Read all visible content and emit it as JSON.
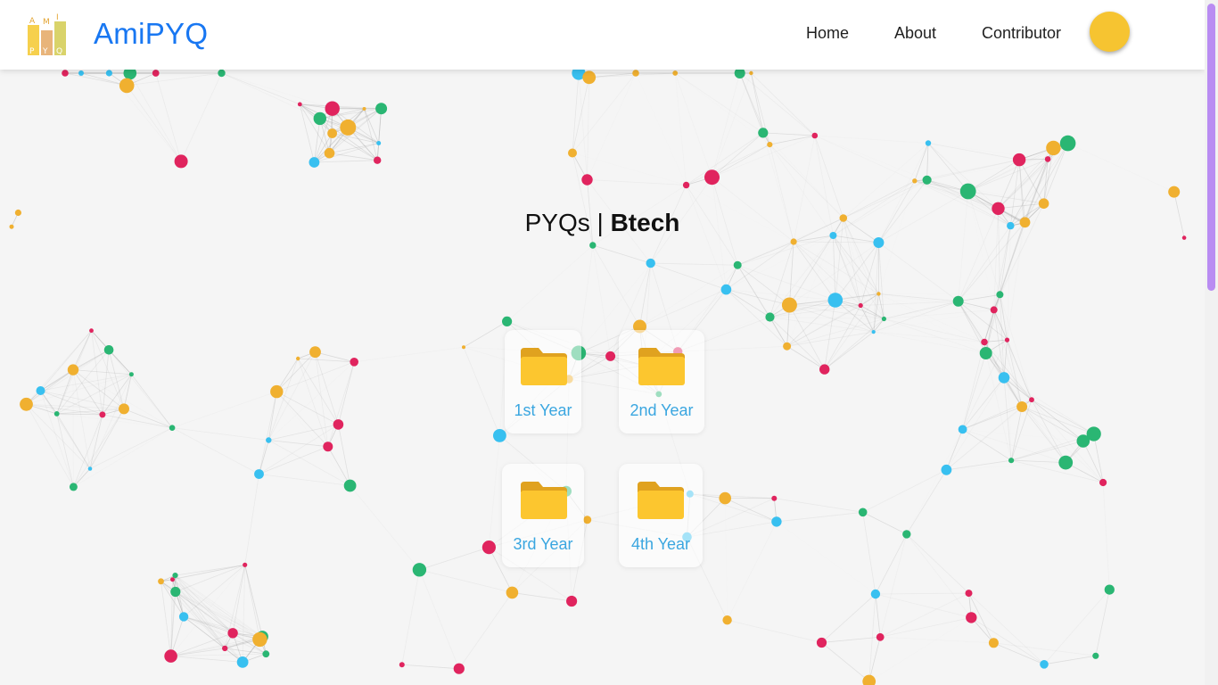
{
  "app": {
    "brand": "AmiPYQ",
    "logo_letters": [
      "A",
      "M",
      "I",
      "P",
      "Y",
      "Q"
    ]
  },
  "nav": {
    "items": [
      {
        "label": "Home"
      },
      {
        "label": "About"
      },
      {
        "label": "Contributor"
      }
    ]
  },
  "theme_toggle": {
    "state": "light"
  },
  "page": {
    "heading_light": "PYQs |",
    "heading_bold": "Btech"
  },
  "folders": [
    {
      "label": "1st Year",
      "icon": "folder-icon"
    },
    {
      "label": "2nd Year",
      "icon": "folder-icon"
    },
    {
      "label": "3rd Year",
      "icon": "folder-icon"
    },
    {
      "label": "4th Year",
      "icon": "folder-icon"
    }
  ],
  "colors": {
    "brand": "#1877f2",
    "folder_label": "#3aa6e0",
    "folder_fill": "#fcc62f",
    "folder_tab": "#e0a21f",
    "toggle_knob": "#f6c431",
    "scroll_thumb": "#b98cf2",
    "particles": [
      "#e0245e",
      "#f0b030",
      "#2ab673",
      "#38c0f0"
    ]
  }
}
